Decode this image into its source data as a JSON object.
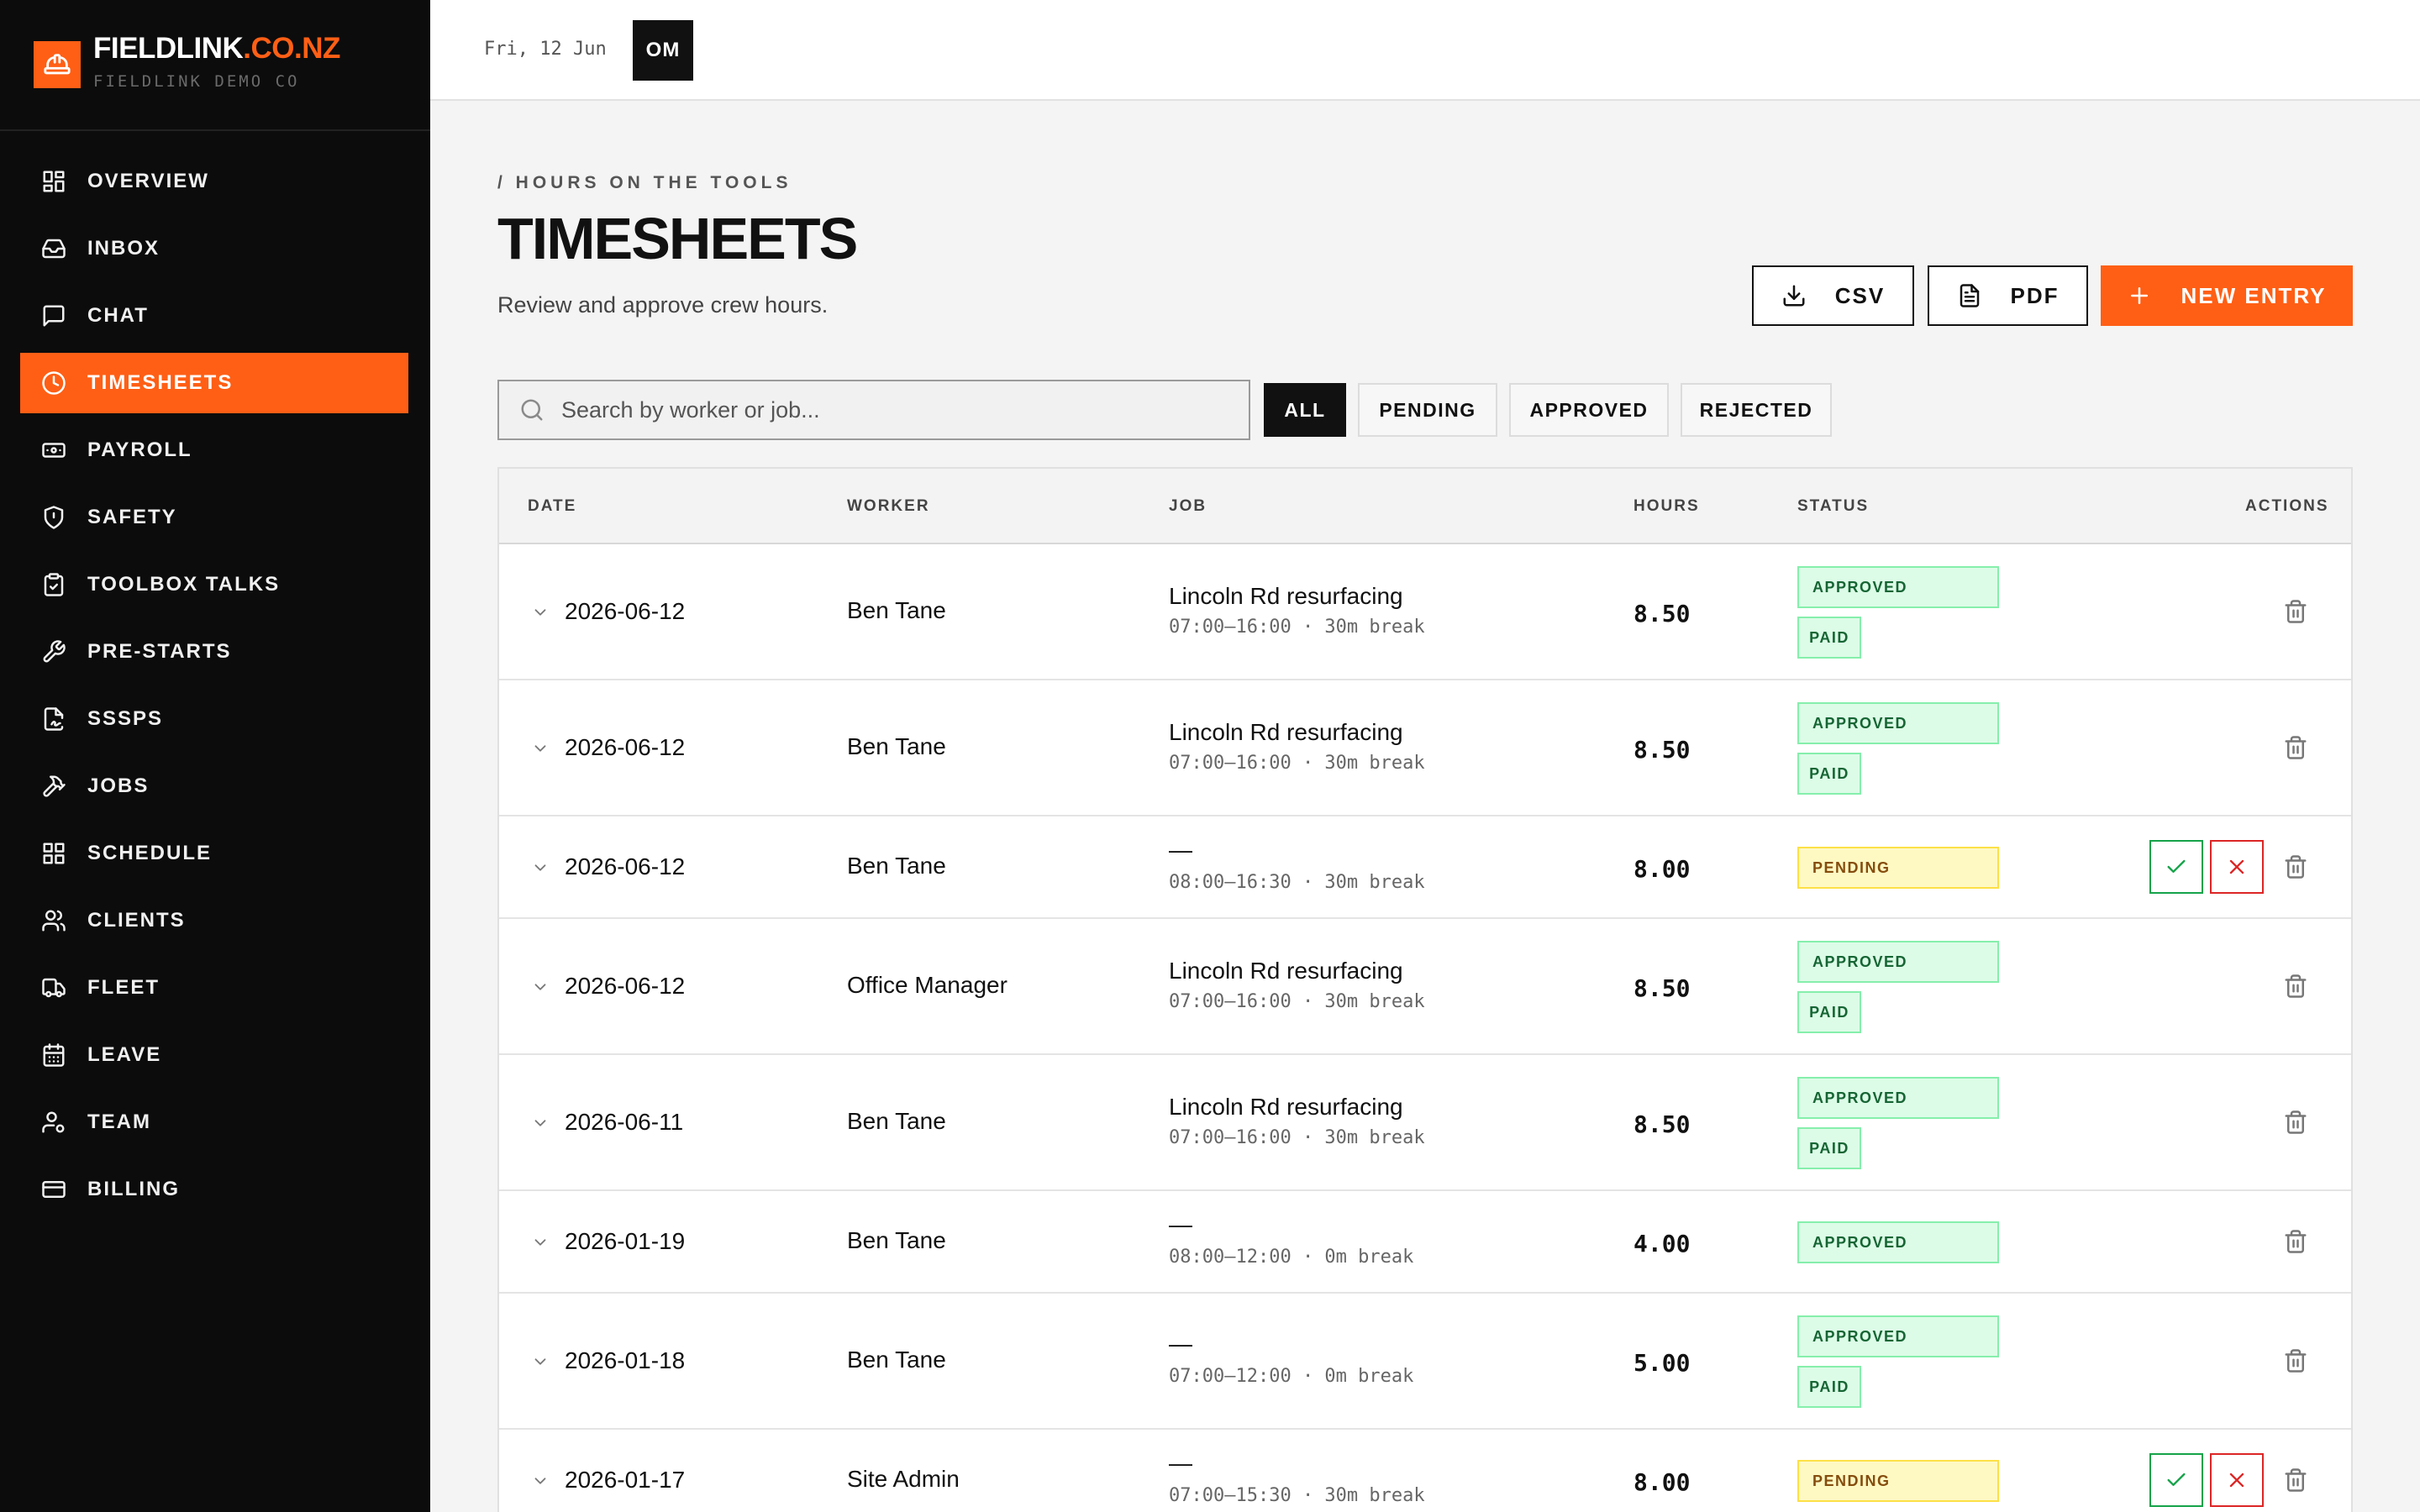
{
  "brand": {
    "name": "FIELDLINK",
    "domain": ".CO.NZ",
    "org": "FIELDLINK DEMO CO",
    "accent_color": "#ff5f15"
  },
  "sidebar": {
    "items": [
      {
        "label": "OVERVIEW",
        "icon": "grid-icon",
        "active": false
      },
      {
        "label": "INBOX",
        "icon": "inbox-icon",
        "active": false
      },
      {
        "label": "CHAT",
        "icon": "chat-icon",
        "active": false
      },
      {
        "label": "TIMESHEETS",
        "icon": "clock-icon",
        "active": true
      },
      {
        "label": "PAYROLL",
        "icon": "banknote-icon",
        "active": false
      },
      {
        "label": "SAFETY",
        "icon": "shield-icon",
        "active": false
      },
      {
        "label": "TOOLBOX TALKS",
        "icon": "clipboard-check-icon",
        "active": false
      },
      {
        "label": "PRE-STARTS",
        "icon": "wrench-icon",
        "active": false
      },
      {
        "label": "SSSPS",
        "icon": "file-signature-icon",
        "active": false
      },
      {
        "label": "JOBS",
        "icon": "hammer-icon",
        "active": false
      },
      {
        "label": "SCHEDULE",
        "icon": "layout-grid-icon",
        "active": false
      },
      {
        "label": "CLIENTS",
        "icon": "users-icon",
        "active": false
      },
      {
        "label": "FLEET",
        "icon": "truck-icon",
        "active": false
      },
      {
        "label": "LEAVE",
        "icon": "calendar-icon",
        "active": false
      },
      {
        "label": "TEAM",
        "icon": "user-cog-icon",
        "active": false
      },
      {
        "label": "BILLING",
        "icon": "credit-card-icon",
        "active": false
      }
    ]
  },
  "topbar": {
    "date": "Fri, 12 Jun",
    "avatar_initials": "OM"
  },
  "page": {
    "breadcrumb": "/ HOURS ON THE TOOLS",
    "title": "TIMESHEETS",
    "subtitle": "Review and approve crew hours.",
    "buttons": {
      "csv": "CSV",
      "pdf": "PDF",
      "new_entry": "NEW ENTRY"
    }
  },
  "search": {
    "placeholder": "Search by worker or job...",
    "value": ""
  },
  "filters": [
    {
      "label": "ALL",
      "active": true
    },
    {
      "label": "PENDING",
      "active": false
    },
    {
      "label": "APPROVED",
      "active": false
    },
    {
      "label": "REJECTED",
      "active": false
    }
  ],
  "table": {
    "columns": {
      "date": "DATE",
      "worker": "WORKER",
      "job": "JOB",
      "hours": "HOURS",
      "status": "STATUS",
      "actions": "ACTIONS"
    },
    "rows": [
      {
        "date": "2026-06-12",
        "worker": "Ben Tane",
        "job": "Lincoln Rd resurfacing",
        "meta": "07:00–16:00 · 30m break",
        "hours": "8.50",
        "status": "APPROVED",
        "paid": "PAID"
      },
      {
        "date": "2026-06-12",
        "worker": "Ben Tane",
        "job": "Lincoln Rd resurfacing",
        "meta": "07:00–16:00 · 30m break",
        "hours": "8.50",
        "status": "APPROVED",
        "paid": "PAID"
      },
      {
        "date": "2026-06-12",
        "worker": "Ben Tane",
        "job": "—",
        "meta": "08:00–16:30 · 30m break",
        "hours": "8.00",
        "status": "PENDING",
        "paid": null
      },
      {
        "date": "2026-06-12",
        "worker": "Office Manager",
        "job": "Lincoln Rd resurfacing",
        "meta": "07:00–16:00 · 30m break",
        "hours": "8.50",
        "status": "APPROVED",
        "paid": "PAID"
      },
      {
        "date": "2026-06-11",
        "worker": "Ben Tane",
        "job": "Lincoln Rd resurfacing",
        "meta": "07:00–16:00 · 30m break",
        "hours": "8.50",
        "status": "APPROVED",
        "paid": "PAID"
      },
      {
        "date": "2026-01-19",
        "worker": "Ben Tane",
        "job": "—",
        "meta": "08:00–12:00 · 0m break",
        "hours": "4.00",
        "status": "APPROVED",
        "paid": null
      },
      {
        "date": "2026-01-18",
        "worker": "Ben Tane",
        "job": "—",
        "meta": "07:00–12:00 · 0m break",
        "hours": "5.00",
        "status": "APPROVED",
        "paid": "PAID"
      },
      {
        "date": "2026-01-17",
        "worker": "Site Admin",
        "job": "—",
        "meta": "07:00–15:30 · 30m break",
        "hours": "8.00",
        "status": "PENDING",
        "paid": null
      }
    ]
  }
}
